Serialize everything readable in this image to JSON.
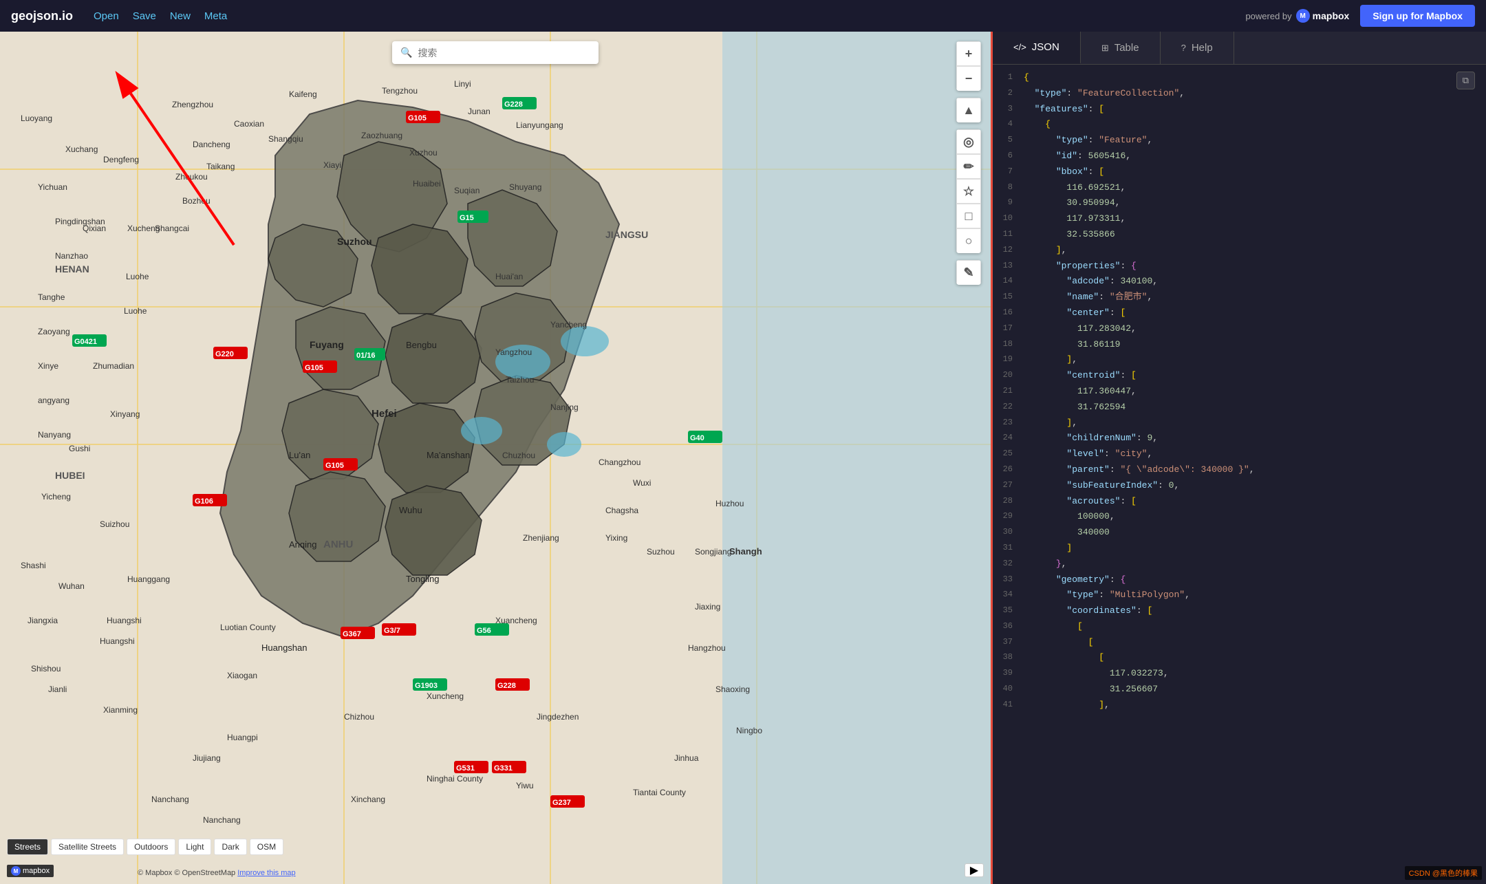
{
  "header": {
    "logo": "geojson.io",
    "nav": [
      {
        "label": "Open",
        "id": "open"
      },
      {
        "label": "Save",
        "id": "save"
      },
      {
        "label": "New",
        "id": "new"
      },
      {
        "label": "Meta",
        "id": "meta"
      }
    ],
    "powered_by": "powered by",
    "mapbox_label": "mapbox",
    "signup_label": "Sign up for Mapbox"
  },
  "search": {
    "placeholder": "搜索"
  },
  "map_controls": {
    "zoom_in": "+",
    "zoom_out": "−",
    "locate": "▲",
    "marker": "◎",
    "draw_line": "✏",
    "star": "☆",
    "rectangle": "□",
    "circle": "○",
    "edit": "✎"
  },
  "map_styles": [
    {
      "label": "Streets",
      "active": true
    },
    {
      "label": "Satellite Streets",
      "active": false
    },
    {
      "label": "Outdoors",
      "active": false
    },
    {
      "label": "Light",
      "active": false
    },
    {
      "label": "Dark",
      "active": false
    },
    {
      "label": "OSM",
      "active": false
    }
  ],
  "panel": {
    "tabs": [
      {
        "label": "JSON",
        "icon": "</>",
        "active": true
      },
      {
        "label": "Table",
        "icon": "⊞",
        "active": false
      },
      {
        "label": "Help",
        "icon": "?",
        "active": false
      }
    ]
  },
  "code_lines": [
    {
      "num": 1,
      "content": "{",
      "type": "bracket"
    },
    {
      "num": 2,
      "content": "  \"type\": \"FeatureCollection\",",
      "type": "kv-string"
    },
    {
      "num": 3,
      "content": "  \"features\": [",
      "type": "kv-bracket"
    },
    {
      "num": 4,
      "content": "    {",
      "type": "bracket"
    },
    {
      "num": 5,
      "content": "      \"type\": \"Feature\",",
      "type": "kv-string"
    },
    {
      "num": 6,
      "content": "      \"id\": 5605416,",
      "type": "kv-number"
    },
    {
      "num": 7,
      "content": "      \"bbox\": [",
      "type": "kv-bracket"
    },
    {
      "num": 8,
      "content": "        116.692521,",
      "type": "number"
    },
    {
      "num": 9,
      "content": "        30.950994,",
      "type": "number"
    },
    {
      "num": 10,
      "content": "        117.973311,",
      "type": "number"
    },
    {
      "num": 11,
      "content": "        32.535866",
      "type": "number"
    },
    {
      "num": 12,
      "content": "      ],",
      "type": "bracket"
    },
    {
      "num": 13,
      "content": "      \"properties\": {",
      "type": "kv-bracket"
    },
    {
      "num": 14,
      "content": "        \"adcode\": 340100,",
      "type": "kv-number"
    },
    {
      "num": 15,
      "content": "        \"name\": \"合肥市\",",
      "type": "kv-string"
    },
    {
      "num": 16,
      "content": "        \"center\": [",
      "type": "kv-bracket"
    },
    {
      "num": 17,
      "content": "          117.283042,",
      "type": "number"
    },
    {
      "num": 18,
      "content": "          31.86119",
      "type": "number"
    },
    {
      "num": 19,
      "content": "        ],",
      "type": "bracket"
    },
    {
      "num": 20,
      "content": "        \"centroid\": [",
      "type": "kv-bracket"
    },
    {
      "num": 21,
      "content": "          117.360447,",
      "type": "number"
    },
    {
      "num": 22,
      "content": "          31.762594",
      "type": "number"
    },
    {
      "num": 23,
      "content": "        ],",
      "type": "bracket"
    },
    {
      "num": 24,
      "content": "        \"childrenNum\": 9,",
      "type": "kv-number"
    },
    {
      "num": 25,
      "content": "        \"level\": \"city\",",
      "type": "kv-string"
    },
    {
      "num": 26,
      "content": "        \"parent\": \"{ \\\"adcode\\\": 340000 }\",",
      "type": "kv-string"
    },
    {
      "num": 27,
      "content": "        \"subFeatureIndex\": 0,",
      "type": "kv-number"
    },
    {
      "num": 28,
      "content": "        \"acroutes\": [",
      "type": "kv-bracket"
    },
    {
      "num": 29,
      "content": "          100000,",
      "type": "number"
    },
    {
      "num": 30,
      "content": "          340000",
      "type": "number"
    },
    {
      "num": 31,
      "content": "        ]",
      "type": "bracket"
    },
    {
      "num": 32,
      "content": "      },",
      "type": "bracket"
    },
    {
      "num": 33,
      "content": "      \"geometry\": {",
      "type": "kv-bracket"
    },
    {
      "num": 34,
      "content": "        \"type\": \"MultiPolygon\",",
      "type": "kv-string"
    },
    {
      "num": 35,
      "content": "        \"coordinates\": [",
      "type": "kv-bracket"
    },
    {
      "num": 36,
      "content": "          [",
      "type": "bracket"
    },
    {
      "num": 37,
      "content": "            [",
      "type": "bracket"
    },
    {
      "num": 38,
      "content": "              [",
      "type": "bracket"
    },
    {
      "num": 39,
      "content": "                117.032273,",
      "type": "number"
    },
    {
      "num": 40,
      "content": "                31.256607",
      "type": "number"
    },
    {
      "num": 41,
      "content": "              ],",
      "type": "bracket"
    }
  ],
  "attribution": {
    "mapbox": "© Mapbox",
    "osm": "© OpenStreetMap",
    "improve": "Improve this map"
  },
  "csdn_watermark": "CSDN @黑色的棒果",
  "copy_button": "⧉"
}
